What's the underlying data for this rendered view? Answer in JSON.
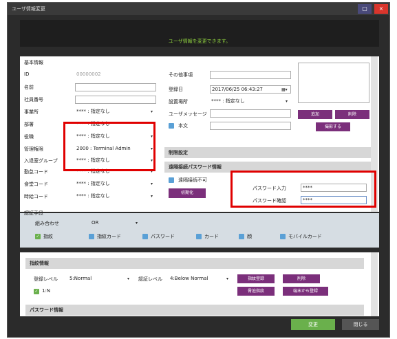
{
  "window": {
    "title": "ユーザ情報変更",
    "max_glyph": "▢",
    "close_glyph": "×"
  },
  "banner": {
    "message": "ユーザ情報を変更できます。"
  },
  "basic_info": {
    "header": "基本情報",
    "fields": [
      {
        "label": "ID",
        "value": "00000002"
      },
      {
        "label": "名前",
        "value": ""
      },
      {
        "label": "社員番号",
        "value": ""
      },
      {
        "label": "事業所",
        "value": "**** : 指定なし"
      },
      {
        "label": "部署",
        "value": "**** : 指定なし"
      },
      {
        "label": "役職",
        "value": "**** : 指定なし"
      },
      {
        "label": "管理権限",
        "value": "2000 : Terminal Admin"
      },
      {
        "label": "入退室グループ",
        "value": "**** : 指定なし"
      },
      {
        "label": "勤怠コード",
        "value": "**** : 指定なし"
      },
      {
        "label": "食堂コード",
        "value": "**** : 指定なし"
      },
      {
        "label": "時給コード",
        "value": "**** : 指定なし"
      }
    ]
  },
  "right_fields": {
    "other_label": "その他事項",
    "other_value": "",
    "reg_date_label": "登録日",
    "reg_date_value": "2017/06/25 06:43:27",
    "location_label": "設置場所",
    "location_value": "**** : 指定なし",
    "message_label": "ユーザメッセージ",
    "message_value": "",
    "body_label": "本文",
    "body_value": ""
  },
  "photo_buttons": {
    "add": "追加",
    "delete": "削除",
    "capture": "撮影する"
  },
  "restriction": {
    "header": "制限設定"
  },
  "remote_password": {
    "header": "遠隔接続パスワード情報",
    "disable_label": "遠隔接続不可",
    "init_button": "初期化",
    "password_label": "パスワード入力",
    "password_value": "****",
    "confirm_label": "パスワード確認",
    "confirm_value": "****"
  },
  "auth": {
    "header": "認証手段",
    "combo_label": "組み合わせ",
    "combo_value": "OR",
    "methods": [
      "指紋",
      "指紋カード",
      "パスワード",
      "カード",
      "顔",
      "モバイルカード"
    ]
  },
  "fingerprint": {
    "header": "指紋情報",
    "reg_level_label": "登録レベル",
    "reg_level_value": "5:Normal",
    "auth_level_label": "認証レベル",
    "auth_level_value": "4:Below Normal",
    "mode": "1:N",
    "buttons": {
      "register": "指紋登録",
      "delete": "削除",
      "duress": "脅迫指紋",
      "from_terminal": "端末から登録"
    }
  },
  "password_info": {
    "header": "パスワード情報"
  },
  "footer": {
    "change": "変更",
    "close": "閉じる"
  },
  "colors": {
    "accent_purple": "#7b2f7b",
    "banner_green": "#8fd13f",
    "highlight_red": "#e00000",
    "ok_green": "#6ab04c",
    "checkbox_blue": "#5aa0d6"
  }
}
